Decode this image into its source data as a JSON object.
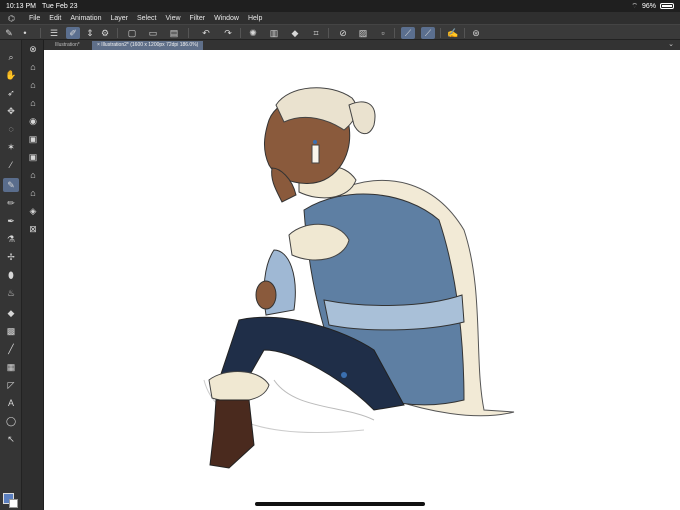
{
  "status": {
    "time": "10:13 PM",
    "date": "Tue Feb 23",
    "battery": "96%",
    "wifi_icon": "wifi-icon",
    "battery_icon": "battery-icon"
  },
  "menu": {
    "items": [
      "File",
      "Edit",
      "Animation",
      "Layer",
      "Select",
      "View",
      "Filter",
      "Window",
      "Help"
    ]
  },
  "tabs": [
    {
      "label": "Illustration*"
    },
    {
      "label": "× Illustration2* (1600 x 1200px 72dpi 186.0%)"
    }
  ],
  "colors": {
    "main_color": "#5b7fbf",
    "sub_color": "#ffffff",
    "accent": "#5a6d8c"
  },
  "artwork": {
    "description_icon": "character-illustration"
  }
}
